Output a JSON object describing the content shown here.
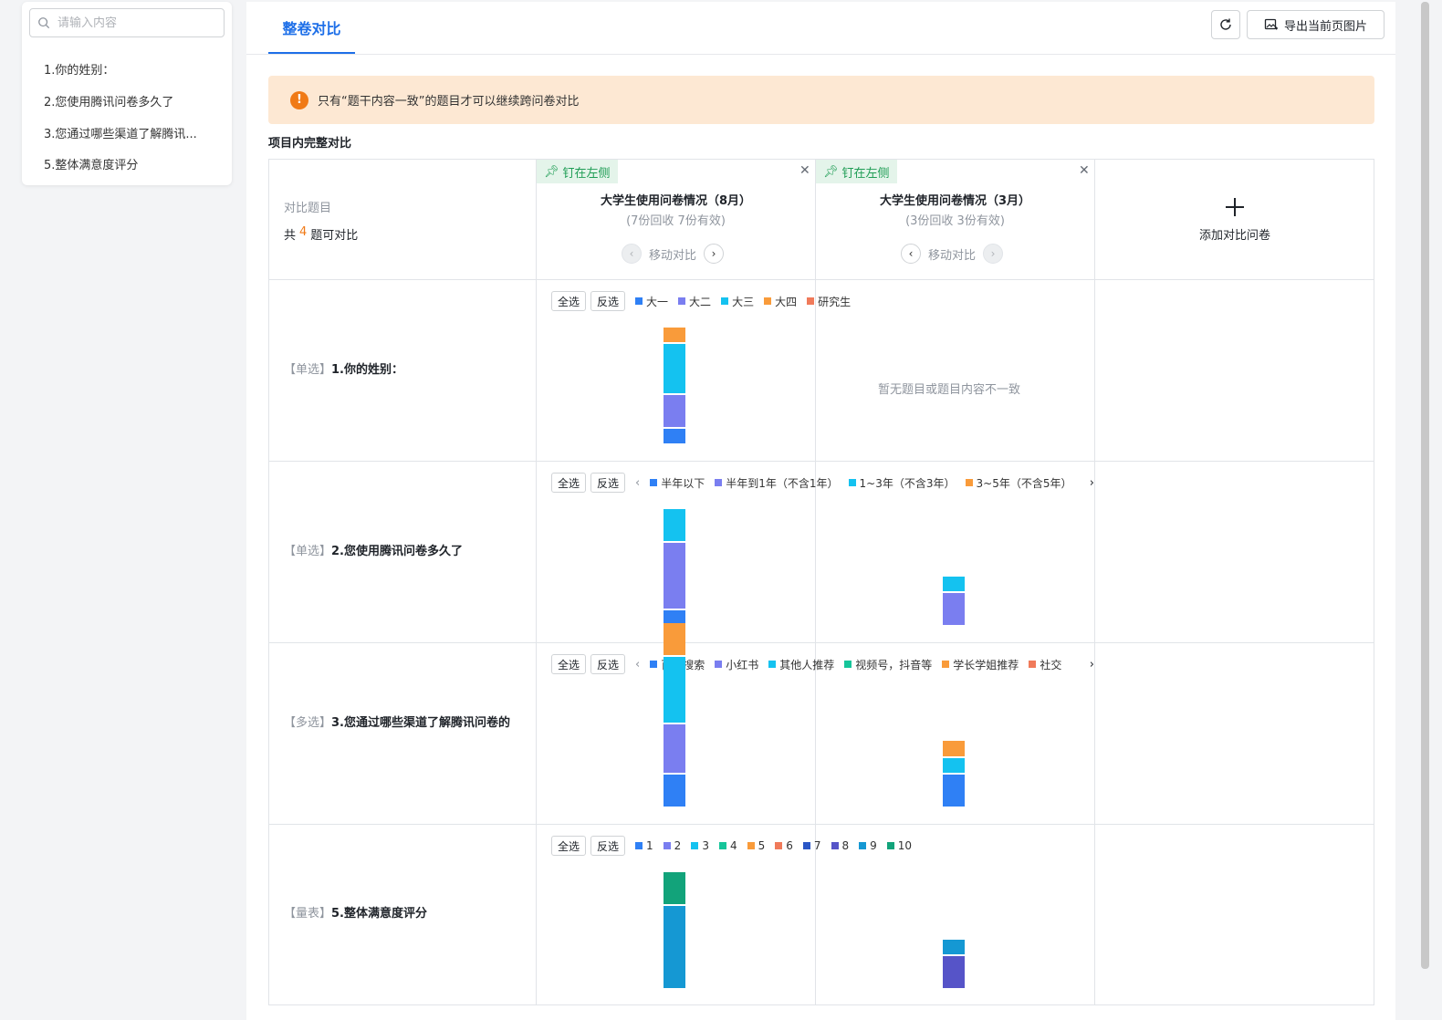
{
  "sidebar": {
    "search_placeholder": "请输入内容",
    "items": [
      "1.你的姓别：",
      "2.您使用腾讯问卷多久了",
      "3.您通过哪些渠道了解腾讯...",
      "5.整体满意度评分"
    ]
  },
  "header": {
    "tab": "整卷对比",
    "export_label": "导出当前页图片"
  },
  "notice": {
    "text": "只有“题干内容一致”的题目才可以继续跨问卷对比"
  },
  "section_title": "项目内完整对比",
  "compare": {
    "label": "对比题目",
    "count_prefix": "共",
    "count": "4",
    "count_suffix": "题可对比",
    "add_label": "添加对比问卷",
    "move_label": "移动对比",
    "pin_label": "钉在左侧",
    "empty_text": "暂无题目或题目内容不一致"
  },
  "surveys": [
    {
      "title": "大学生使用问卷情况（8月）",
      "stats": "(7份回收 7份有效)"
    },
    {
      "title": "大学生使用问卷情况（3月）",
      "stats": "(3份回收 3份有效)"
    }
  ],
  "controls": {
    "select_all": "全选",
    "invert": "反选"
  },
  "colors": {
    "blue": "#2f80f5",
    "purple": "#7a7ef0",
    "cyan": "#14c2f0",
    "orange": "#f99b3a",
    "red": "#f07a5a",
    "green": "#16c59a",
    "navy": "#2a56c6",
    "indigo": "#5654c8",
    "teal": "#1598d3",
    "dkgreen": "#12a37a"
  },
  "questions": [
    {
      "tag": "【单选】",
      "title": "1.你的姓别：",
      "legend": [
        "大一",
        "大二",
        "大三",
        "大四",
        "研究生"
      ],
      "has_arrows": false
    },
    {
      "tag": "【单选】",
      "title": "2.您使用腾讯问卷多久了",
      "legend": [
        "半年以下",
        "半年到1年（不含1年）",
        "1~3年（不含3年）",
        "3~5年（不含5年）"
      ],
      "has_arrows": true
    },
    {
      "tag": "【多选】",
      "title": "3.您通过哪些渠道了解腾讯问卷的",
      "legend": [
        "百度搜索",
        "小红书",
        "其他人推荐",
        "视频号，抖音等",
        "学长学姐推荐",
        "社交"
      ],
      "has_arrows": true
    },
    {
      "tag": "【量表】",
      "title": "5.整体满意度评分",
      "legend": [
        "1",
        "2",
        "3",
        "4",
        "5",
        "6",
        "7",
        "8",
        "9",
        "10"
      ],
      "has_arrows": false
    }
  ],
  "chart_data": [
    {
      "type": "bar",
      "stacked": true,
      "question": "1.你的姓别：",
      "categories": [
        "大学生使用问卷情况（8月）"
      ],
      "series": [
        {
          "name": "大一",
          "values": [
            1
          ]
        },
        {
          "name": "大二",
          "values": [
            2
          ]
        },
        {
          "name": "大三",
          "values": [
            3
          ]
        },
        {
          "name": "大四",
          "values": [
            1
          ]
        }
      ]
    },
    {
      "type": "bar",
      "stacked": true,
      "question": "2.您使用腾讯问卷多久了",
      "categories": [
        "大学生使用问卷情况（8月）",
        "大学生使用问卷情况（3月）"
      ],
      "series": [
        {
          "name": "半年以下",
          "values": [
            1,
            0
          ]
        },
        {
          "name": "半年到1年（不含1年）",
          "values": [
            4,
            2
          ]
        },
        {
          "name": "1~3年（不含3年）",
          "values": [
            2,
            1
          ]
        }
      ]
    },
    {
      "type": "bar",
      "stacked": true,
      "question": "3.您通过哪些渠道了解腾讯问卷的",
      "categories": [
        "大学生使用问卷情况（8月）",
        "大学生使用问卷情况（3月）"
      ],
      "series": [
        {
          "name": "百度搜索",
          "values": [
            2,
            2
          ]
        },
        {
          "name": "小红书",
          "values": [
            3,
            0
          ]
        },
        {
          "name": "其他人推荐",
          "values": [
            4,
            1
          ]
        },
        {
          "name": "学长学姐推荐",
          "values": [
            2,
            1
          ]
        }
      ]
    },
    {
      "type": "bar",
      "stacked": true,
      "question": "5.整体满意度评分",
      "categories": [
        "大学生使用问卷情况（8月）",
        "大学生使用问卷情况（3月）"
      ],
      "series": [
        {
          "name": "8",
          "values": [
            0,
            2
          ]
        },
        {
          "name": "9",
          "values": [
            5,
            1
          ]
        },
        {
          "name": "10",
          "values": [
            2,
            0
          ]
        }
      ]
    }
  ]
}
